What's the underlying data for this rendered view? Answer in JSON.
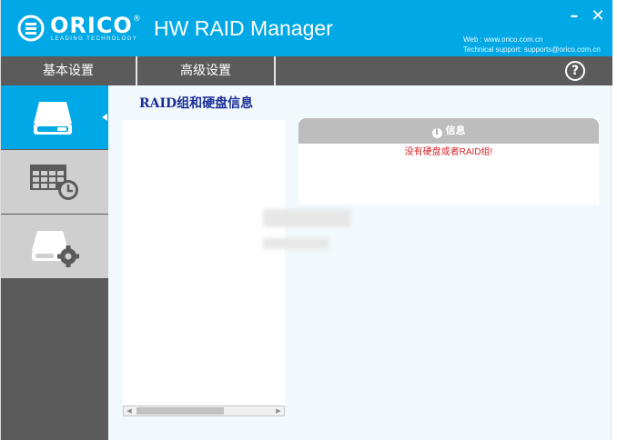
{
  "window": {
    "brand_name": "ORICO",
    "brand_reg": "®",
    "brand_tagline": "LEADING   TECHNOLOGY",
    "app_title": "HW RAID Manager",
    "minimize_label": "–",
    "close_label": "✕",
    "contact_web": "Web : www.orico.com.cn",
    "contact_support": "Technical support: supports@orico.com.cn"
  },
  "tabs": [
    {
      "label": "基本设置"
    },
    {
      "label": "高级设置"
    }
  ],
  "help_label": "?",
  "sidebar": {
    "items": [
      {
        "icon": "hard-drive-icon",
        "active": true
      },
      {
        "icon": "grid-clock-icon",
        "active": false
      },
      {
        "icon": "drive-gear-icon",
        "active": false
      }
    ]
  },
  "content": {
    "title": "RAID组和硬盘信息",
    "info_panel": {
      "header": "信息",
      "message": "没有硬盘或者RAID组!"
    },
    "scrollbar": {
      "left_arrow": "◀",
      "right_arrow": "▶"
    }
  },
  "colors": {
    "accent": "#00a8e6",
    "dark_gray": "#5b5b5b",
    "title_blue": "#1a2d96",
    "error_red": "#d4232a"
  }
}
